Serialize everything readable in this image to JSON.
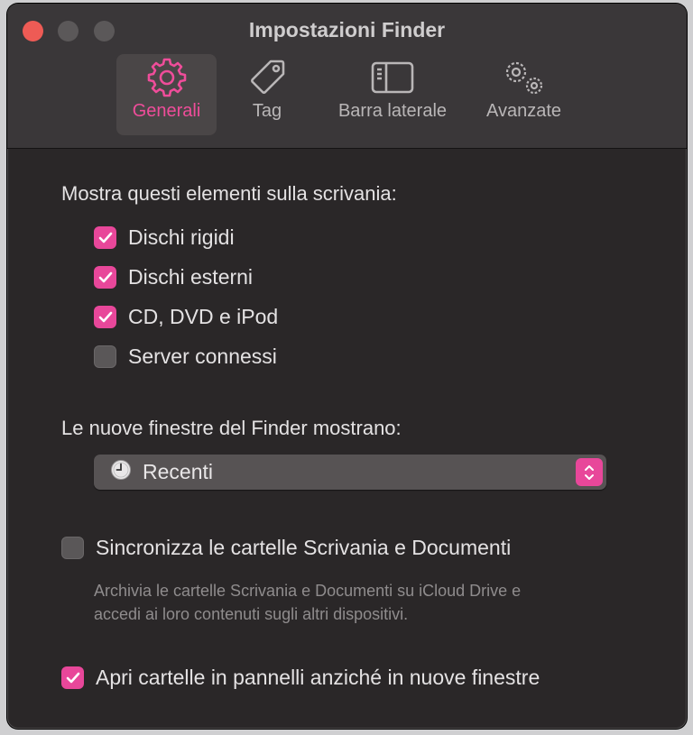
{
  "window": {
    "title": "Impostazioni Finder"
  },
  "tabs": [
    {
      "label": "Generali",
      "icon": "gear-icon",
      "active": true
    },
    {
      "label": "Tag",
      "icon": "tag-icon",
      "active": false
    },
    {
      "label": "Barra laterale",
      "icon": "sidebar-icon",
      "active": false
    },
    {
      "label": "Avanzate",
      "icon": "gears-icon",
      "active": false
    }
  ],
  "desktop": {
    "heading": "Mostra questi elementi sulla scrivania:",
    "items": [
      {
        "label": "Dischi rigidi",
        "checked": true
      },
      {
        "label": "Dischi esterni",
        "checked": true
      },
      {
        "label": "CD, DVD e iPod",
        "checked": true
      },
      {
        "label": "Server connessi",
        "checked": false
      }
    ]
  },
  "new_windows": {
    "heading": "Le nuove finestre del Finder mostrano:",
    "selected": "Recenti",
    "icon": "clock-icon"
  },
  "icloud_sync": {
    "label": "Sincronizza le cartelle Scrivania e Documenti",
    "checked": false,
    "description": "Archivia le cartelle Scrivania e Documenti su iCloud Drive e accedi ai loro contenuti sugli altri dispositivi."
  },
  "open_tabs": {
    "label": "Apri cartelle in pannelli anziché in nuove finestre",
    "checked": true
  },
  "colors": {
    "accent": "#e8479a",
    "window_bg": "#2a2728",
    "toolbar_bg": "#3a3739"
  }
}
